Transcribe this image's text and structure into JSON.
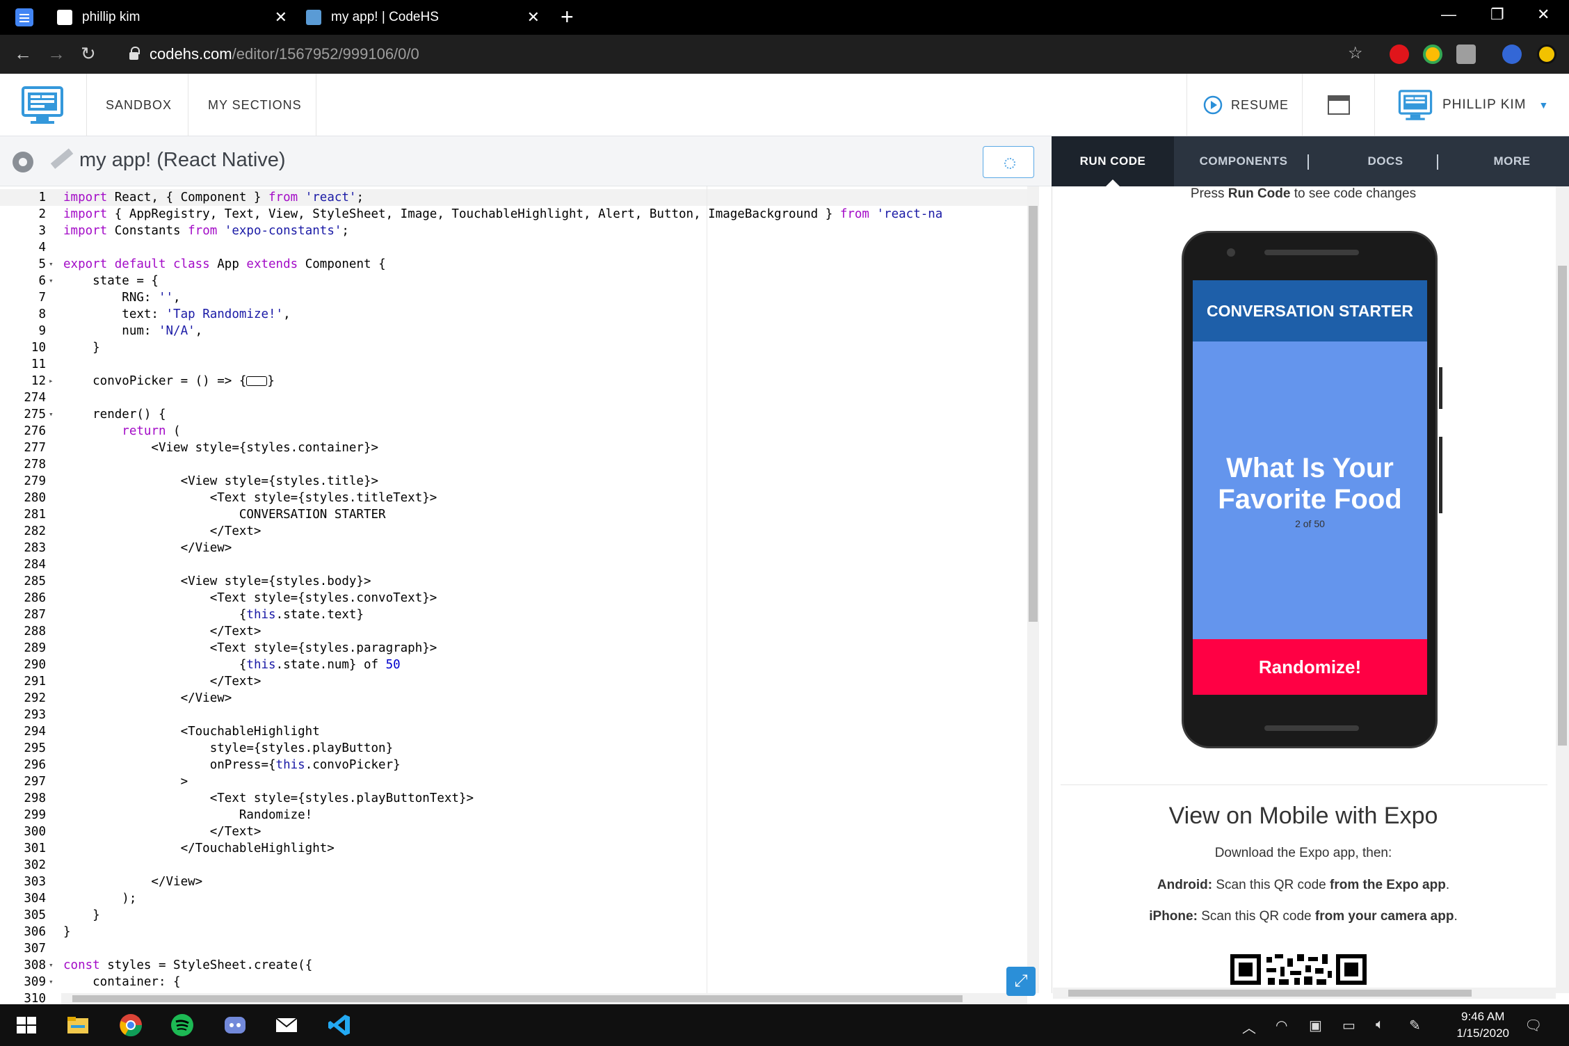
{
  "browser": {
    "tabs": [
      {
        "title": "phillip kim",
        "active": false
      },
      {
        "title": "my app! | CodeHS",
        "active": true
      }
    ],
    "url_host": "codehs.com",
    "url_path": "/editor/1567952/999106/0/0"
  },
  "header": {
    "nav": [
      "SANDBOX",
      "MY SECTIONS"
    ],
    "resume_label": "RESUME",
    "user_name": "PHILLIP KIM"
  },
  "editor": {
    "program_title": "my app! (React Native)",
    "lines": [
      {
        "n": "1",
        "fold": "",
        "html": "<span class=\"kw\">import</span> React, { Component } <span class=\"kw\">from</span> <span class=\"str\">'react'</span>;"
      },
      {
        "n": "2",
        "fold": "",
        "html": "<span class=\"kw\">import</span> { AppRegistry, Text, View, StyleSheet, Image, TouchableHighlight, Alert, Button, ImageBackground } <span class=\"kw\">from</span> <span class=\"str\">'react-na</span>"
      },
      {
        "n": "3",
        "fold": "",
        "html": "<span class=\"kw\">import</span> Constants <span class=\"kw\">from</span> <span class=\"str\">'expo-constants'</span>;"
      },
      {
        "n": "4",
        "fold": "",
        "html": ""
      },
      {
        "n": "5",
        "fold": "▾",
        "html": "<span class=\"kw\">export default class</span> App <span class=\"kw\">extends</span> Component {"
      },
      {
        "n": "6",
        "fold": "▾",
        "html": "    state = {"
      },
      {
        "n": "7",
        "fold": "",
        "html": "        RNG: <span class=\"str\">''</span>,"
      },
      {
        "n": "8",
        "fold": "",
        "html": "        text: <span class=\"str\">'Tap Randomize!'</span>,"
      },
      {
        "n": "9",
        "fold": "",
        "html": "        num: <span class=\"str\">'N/A'</span>,"
      },
      {
        "n": "10",
        "fold": "",
        "html": "    }"
      },
      {
        "n": "11",
        "fold": "",
        "html": ""
      },
      {
        "n": "12",
        "fold": "▸",
        "html": "    convoPicker = () => {<span style=\"display:inline-block;width:30px;height:14px;border:1px solid #000;border-radius:3px;vertical-align:middle;\"></span>}"
      },
      {
        "n": "274",
        "fold": "",
        "html": ""
      },
      {
        "n": "275",
        "fold": "▾",
        "html": "    render() {"
      },
      {
        "n": "276",
        "fold": "",
        "html": "        <span class=\"kw\">return</span> ("
      },
      {
        "n": "277",
        "fold": "",
        "html": "            &lt;View style={styles.container}&gt;"
      },
      {
        "n": "278",
        "fold": "",
        "html": ""
      },
      {
        "n": "279",
        "fold": "",
        "html": "                &lt;View style={styles.title}&gt;"
      },
      {
        "n": "280",
        "fold": "",
        "html": "                    &lt;Text style={styles.titleText}&gt;"
      },
      {
        "n": "281",
        "fold": "",
        "html": "                        CONVERSATION STARTER"
      },
      {
        "n": "282",
        "fold": "",
        "html": "                    &lt;/Text&gt;"
      },
      {
        "n": "283",
        "fold": "",
        "html": "                &lt;/View&gt;"
      },
      {
        "n": "284",
        "fold": "",
        "html": ""
      },
      {
        "n": "285",
        "fold": "",
        "html": "                &lt;View style={styles.body}&gt;"
      },
      {
        "n": "286",
        "fold": "",
        "html": "                    &lt;Text style={styles.convoText}&gt;"
      },
      {
        "n": "287",
        "fold": "",
        "html": "                        {<span class=\"this\">this</span>.state.text}"
      },
      {
        "n": "288",
        "fold": "",
        "html": "                    &lt;/Text&gt;"
      },
      {
        "n": "289",
        "fold": "",
        "html": "                    &lt;Text style={styles.paragraph}&gt;"
      },
      {
        "n": "290",
        "fold": "",
        "html": "                        {<span class=\"this\">this</span>.state.num} of <span class=\"num\">50</span>"
      },
      {
        "n": "291",
        "fold": "",
        "html": "                    &lt;/Text&gt;"
      },
      {
        "n": "292",
        "fold": "",
        "html": "                &lt;/View&gt;"
      },
      {
        "n": "293",
        "fold": "",
        "html": ""
      },
      {
        "n": "294",
        "fold": "",
        "html": "                &lt;TouchableHighlight"
      },
      {
        "n": "295",
        "fold": "",
        "html": "                    style={styles.playButton}"
      },
      {
        "n": "296",
        "fold": "",
        "html": "                    onPress={<span class=\"this\">this</span>.convoPicker}"
      },
      {
        "n": "297",
        "fold": "",
        "html": "                &gt;"
      },
      {
        "n": "298",
        "fold": "",
        "html": "                    &lt;Text style={styles.playButtonText}&gt;"
      },
      {
        "n": "299",
        "fold": "",
        "html": "                        Randomize!"
      },
      {
        "n": "300",
        "fold": "",
        "html": "                    &lt;/Text&gt;"
      },
      {
        "n": "301",
        "fold": "",
        "html": "                &lt;/TouchableHighlight&gt;"
      },
      {
        "n": "302",
        "fold": "",
        "html": ""
      },
      {
        "n": "303",
        "fold": "",
        "html": "            &lt;/View&gt;"
      },
      {
        "n": "304",
        "fold": "",
        "html": "        );"
      },
      {
        "n": "305",
        "fold": "",
        "html": "    }"
      },
      {
        "n": "306",
        "fold": "",
        "html": "}"
      },
      {
        "n": "307",
        "fold": "",
        "html": ""
      },
      {
        "n": "308",
        "fold": "▾",
        "html": "<span class=\"kw\">const</span> styles = StyleSheet.create({"
      },
      {
        "n": "309",
        "fold": "▾",
        "html": "    container: {"
      },
      {
        "n": "310",
        "fold": "",
        "html": ""
      }
    ]
  },
  "right_panel": {
    "tabs": [
      "RUN CODE",
      "COMPONENTS",
      "DOCS",
      "MORE"
    ],
    "run_hint_pre": "Press ",
    "run_hint_bold": "Run Code",
    "run_hint_post": " to see code changes",
    "app": {
      "title": "CONVERSATION STARTER",
      "convo_text": "What Is Your Favorite Food",
      "count": "2 of 50",
      "button": "Randomize!"
    },
    "expo": {
      "title": "View on Mobile with Expo",
      "download": "Download the Expo app, then:",
      "android_label": "Android:",
      "android_text": " Scan this QR code ",
      "android_bold": "from the Expo app",
      "iphone_label": "iPhone:",
      "iphone_text": " Scan this QR code ",
      "iphone_bold": "from your camera app"
    }
  },
  "taskbar": {
    "time": "9:46 AM",
    "date": "1/15/2020"
  },
  "colors": {
    "app_title_bg": "#1e5fa9",
    "app_body_bg": "#6495ed",
    "app_button_bg": "#ff0044",
    "right_tabs_bg": "#2b3440"
  }
}
